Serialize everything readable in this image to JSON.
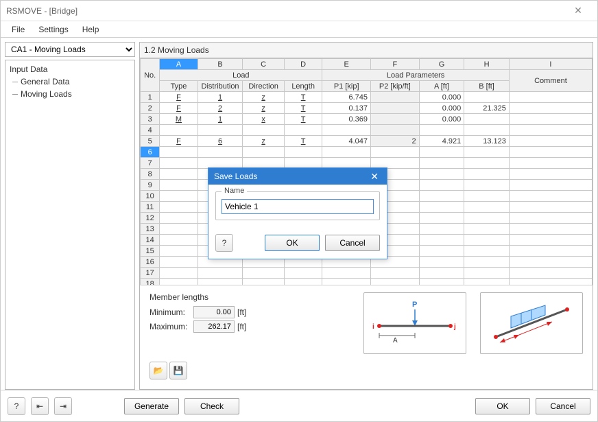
{
  "window": {
    "title": "RSMOVE - [Bridge]"
  },
  "menu": {
    "file": "File",
    "settings": "Settings",
    "help": "Help"
  },
  "sidebar": {
    "selector": "CA1 - Moving Loads",
    "root": "Input Data",
    "items": [
      "General Data",
      "Moving Loads"
    ]
  },
  "panel": {
    "title": "1.2 Moving Loads",
    "col_letters": [
      "A",
      "B",
      "C",
      "D",
      "E",
      "F",
      "G",
      "H",
      "I"
    ],
    "group_headers": {
      "no": "No.",
      "load": "Load",
      "params": "Load Parameters"
    },
    "sub_headers": [
      "Type",
      "Distribution",
      "Direction",
      "Length",
      "P1 [kip]",
      "P2 [kip/ft]",
      "A [ft]",
      "B [ft]",
      "Comment"
    ],
    "rows": [
      {
        "no": 1,
        "type": "F",
        "dist": "1",
        "dir": "z",
        "len": "T",
        "p1": "6.745",
        "p2": "",
        "a": "0.000",
        "b": "",
        "comment": ""
      },
      {
        "no": 2,
        "type": "F",
        "dist": "2",
        "dir": "z",
        "len": "T",
        "p1": "0.137",
        "p2": "",
        "a": "0.000",
        "b": "21.325",
        "comment": ""
      },
      {
        "no": 3,
        "type": "M",
        "dist": "1",
        "dir": "x",
        "len": "T",
        "p1": "0.369",
        "p2": "",
        "a": "0.000",
        "b": "",
        "comment": ""
      },
      {
        "no": 4,
        "type": "",
        "dist": "",
        "dir": "",
        "len": "",
        "p1": "",
        "p2": "",
        "a": "",
        "b": "",
        "comment": ""
      },
      {
        "no": 5,
        "type": "F",
        "dist": "6",
        "dir": "z",
        "len": "T",
        "p1": "4.047",
        "p2": "2",
        "a": "4.921",
        "b": "13.123",
        "comment": ""
      }
    ],
    "empty_rows": 13,
    "selected_row": 6
  },
  "member": {
    "title": "Member lengths",
    "min_label": "Minimum:",
    "max_label": "Maximum:",
    "min": "0.00",
    "max": "262.17",
    "unit": "[ft]"
  },
  "preview": {
    "beam": {
      "p_label": "P",
      "left": "i",
      "right": "j",
      "dim": "A"
    }
  },
  "dialog": {
    "title": "Save Loads",
    "group": "Name",
    "value": "Vehicle 1",
    "ok": "OK",
    "cancel": "Cancel"
  },
  "bottom": {
    "generate": "Generate",
    "check": "Check",
    "ok": "OK",
    "cancel": "Cancel"
  }
}
